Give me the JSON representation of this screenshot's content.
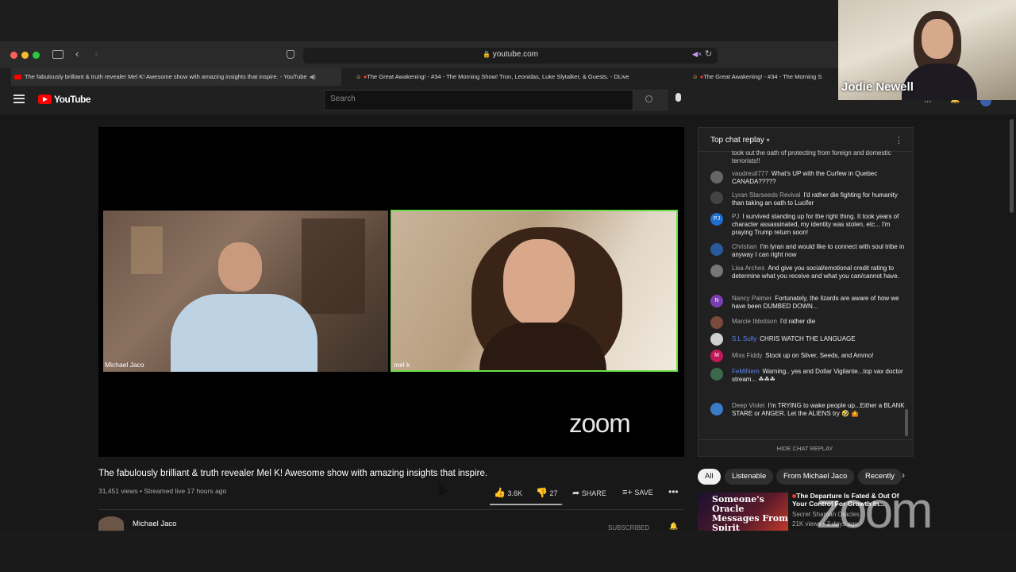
{
  "browser": {
    "url": "youtube.com",
    "tabs": [
      {
        "label": "The fabulously brilliant & truth revealer Mel K! Awesome show with amazing insights that inspire. - YouTube"
      },
      {
        "label": "The Great Awakening! - #34 - The Morning Show! Tron, Leonidas, Luke Slytalker, & Guests. - DLive"
      },
      {
        "label": "The Great Awakening! - #34 - The Morning S"
      }
    ]
  },
  "youtube": {
    "logo": "YouTube",
    "search_placeholder": "Search"
  },
  "player": {
    "left_name": "Michael Jaco",
    "right_name": "mel k",
    "zoom_logo": "zoom"
  },
  "video": {
    "title": "The fabulously brilliant & truth revealer Mel K! Awesome show with amazing insights that inspire.",
    "views": "31,451 views • Streamed live 17 hours ago",
    "likes": "3.6K",
    "dislikes": "27",
    "share": "SHARE",
    "save": "SAVE",
    "channel": "Michael Jaco",
    "subscribed": "SUBSCRIBED"
  },
  "chat": {
    "header": "Top chat replay",
    "hide": "HIDE CHAT REPLAY",
    "messages": [
      {
        "author": "",
        "text": "took out the oath of protecting from foreign and domestic terrorists!!"
      },
      {
        "author": "vaudreuil777",
        "text": "What's UP with the Curfew in Quebec CANADA?????"
      },
      {
        "author": "Lyran Starseeds Revival",
        "text": "I'd rather die fighting for humanity than taking an oath to Lucifer"
      },
      {
        "author": "PJ",
        "text": "I survived standing up for the right thing. It took years of character assassinated, my identity was stolen, etc... I'm praying Trump return soon!"
      },
      {
        "author": "Christian",
        "text": "I'm lyran and would like to connect with soul tribe in anyway I can right now"
      },
      {
        "author": "Lisa Arches",
        "text": "And give you social/emotional credit rating to determine what you receive and what you can/cannot have."
      },
      {
        "author": "Nancy Palmer",
        "text": "Fortunately, the lizards are aware of how we have been DUMBED DOWN..."
      },
      {
        "author": "Marcie Ibbotson",
        "text": "I'd rather die"
      },
      {
        "author": "S.L Sully",
        "text": "CHRIS WATCH THE LANGUAGE"
      },
      {
        "author": "Miss Fiddy",
        "text": "Stock up on Silver, Seeds, and Ammo!"
      },
      {
        "author": "FeMiNem",
        "text": "Warning.. yes and Dollar Vigilante...top vax doctor stream... ☘☘☘"
      },
      {
        "author": "Deep Violet",
        "text": "I'm TRYING to wake people up...Either a BLANK STARE or ANGER. Let the ALIENS try 🤣 🤷"
      }
    ],
    "avatars": {
      "pj": "PJ",
      "n": "N",
      "m": "M"
    }
  },
  "related": {
    "chips": [
      "All",
      "Listenable",
      "From Michael Jaco",
      "Recently"
    ],
    "thumb_text": "Someone's Oracle Messages From Spirit",
    "video_title": "The Departure Is Fated & Out Of Your Control For Growth In...",
    "channel": "Secret Shaman Oracles",
    "meta": "21K views • 2 days ago"
  },
  "overlay": {
    "participant_name": "Jodie Newell",
    "zoom_watermark": "zoom"
  },
  "colors": {
    "accent_green": "#6ce04a",
    "yt_red": "#ff0000"
  }
}
